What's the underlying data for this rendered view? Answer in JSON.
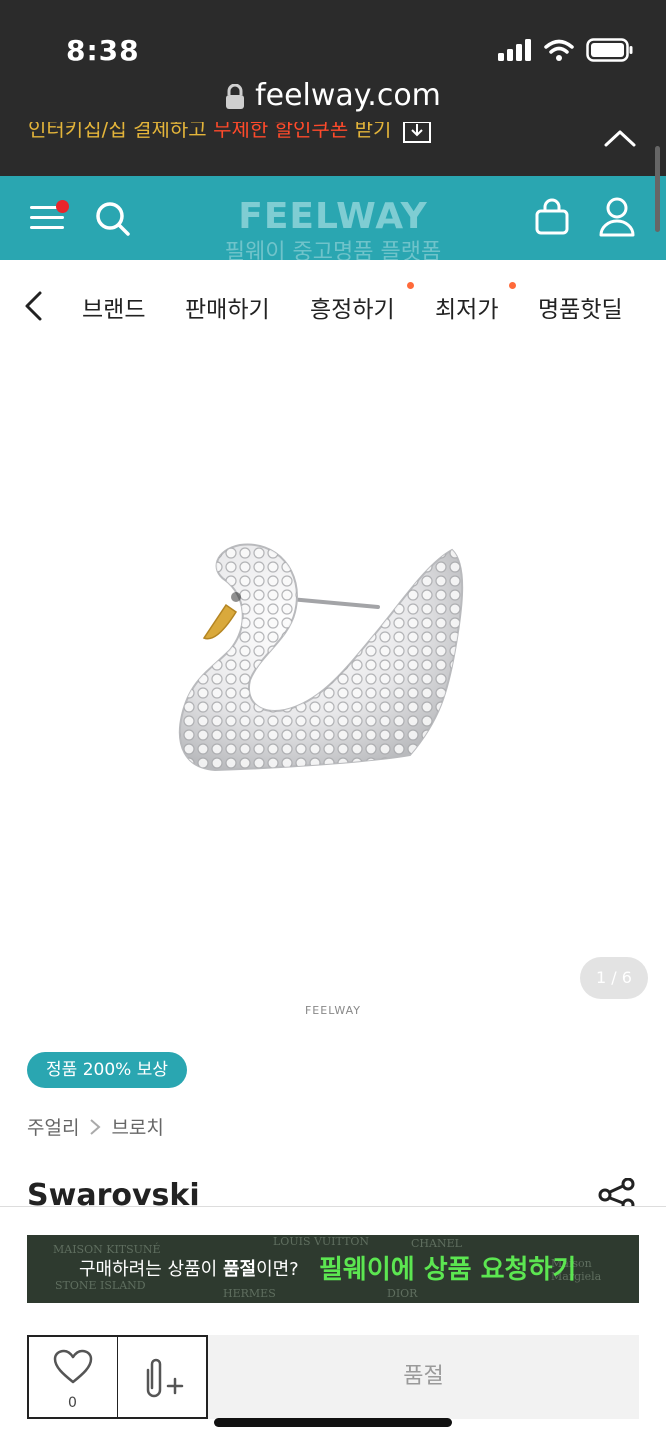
{
  "status": {
    "time": "8:38"
  },
  "browser": {
    "url": "feelway.com"
  },
  "promo": {
    "text_a": "인터키집/집 결제하고 ",
    "text_b": "무제한 할인쿠폰",
    "text_c": " 받기"
  },
  "header": {
    "logo": "FEELWAY",
    "tagline": "필웨이 중고명품 플랫폼"
  },
  "nav": {
    "items": [
      "브랜드",
      "판매하기",
      "흥정하기",
      "최저가",
      "명품핫딜"
    ]
  },
  "gallery": {
    "counter": "1 / 6",
    "watermark": "FEELWAY"
  },
  "product": {
    "badge": "정품 200% 보상",
    "category": [
      "주얼리",
      "브로치"
    ],
    "brand": "Swarovski"
  },
  "request_banner": {
    "question_pre": "구매하려는 상품이 ",
    "question_bold": "품절",
    "question_post": "이면?",
    "cta": "필웨이에 상품 요청하기",
    "bg_words": [
      "MAISON KITSUNÉ",
      "LOUIS VUITTON",
      "CHANEL",
      "STONE ISLAND",
      "HERMES",
      "DIOR",
      "Maison Margiela"
    ]
  },
  "actions": {
    "like_count": "0",
    "soldout_label": "품절"
  },
  "colors": {
    "teal": "#2aa6b1",
    "cta_green": "#5ce651",
    "dark": "#2b2b2b"
  }
}
